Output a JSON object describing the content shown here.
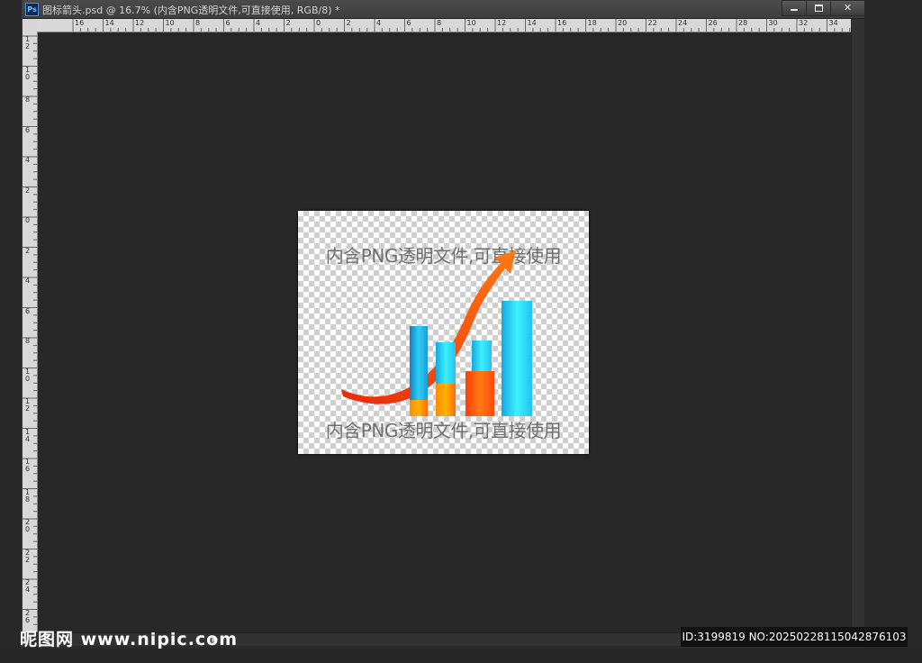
{
  "window": {
    "app_icon": "Ps",
    "title": "图标箭头.psd @ 16.7% (内含PNG透明文件,可直接使用, RGB/8) *",
    "buttons": {
      "minimize": "minimize-icon",
      "maximize": "maximize-icon",
      "close": "close-icon"
    }
  },
  "rulers": {
    "horizontal": [
      "16",
      "14",
      "12",
      "10",
      "8",
      "6",
      "4",
      "2",
      "0",
      "2",
      "4",
      "6",
      "8",
      "10",
      "12",
      "14",
      "16",
      "18",
      "20",
      "22",
      "24",
      "26",
      "28",
      "30",
      "32",
      "34"
    ],
    "vertical": [
      "12",
      "10",
      "8",
      "6",
      "4",
      "2",
      "0",
      "2",
      "4",
      "6",
      "8",
      "10",
      "12",
      "14",
      "16",
      "18",
      "20",
      "22",
      "24",
      "26"
    ]
  },
  "canvas": {
    "text_top": "内含PNG透明文件,可直接使用",
    "text_bottom": "内含PNG透明文件,可直接使用",
    "artwork": "bar-chart-with-rising-arrow",
    "colors": {
      "arrow": "#ff4a12",
      "bar_blue": "#1aa6e0",
      "bar_cyan": "#2fe0ff",
      "bar_orange": "#ff7a00"
    }
  },
  "watermark": {
    "left": "昵图网 www.nipic.com",
    "right": "ID:3199819 NO:20250228115042876103"
  }
}
